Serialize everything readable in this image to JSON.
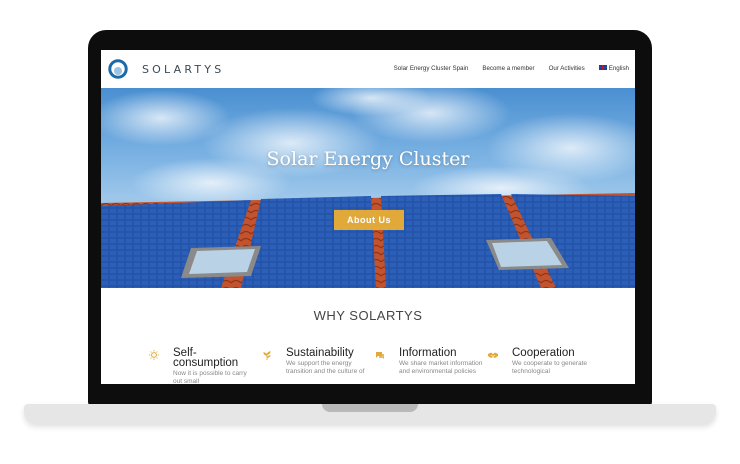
{
  "brand": {
    "name": "SOLARTYS"
  },
  "nav": {
    "items": [
      "Solar Energy Cluster Spain",
      "Become a member",
      "Our Activities"
    ],
    "language": "English"
  },
  "hero": {
    "title": "Solar Energy Cluster",
    "button": "About Us"
  },
  "why": {
    "title": "WHY SOLARTYS",
    "features": [
      {
        "icon": "sun-icon",
        "title": "Self-consumption",
        "text": "Now it is possible to carry out small"
      },
      {
        "icon": "leaf-icon",
        "title": "Sustainability",
        "text": "We support the energy transition and the culture of"
      },
      {
        "icon": "chat-icon",
        "title": "Information",
        "text": "We share market information and environmental policies"
      },
      {
        "icon": "handshake-icon",
        "title": "Cooperation",
        "text": "We cooperate to generate technological"
      }
    ]
  },
  "colors": {
    "accent": "#e1a93a",
    "brand": "#3c4a55",
    "logo_ring": "#1c6aa8"
  }
}
